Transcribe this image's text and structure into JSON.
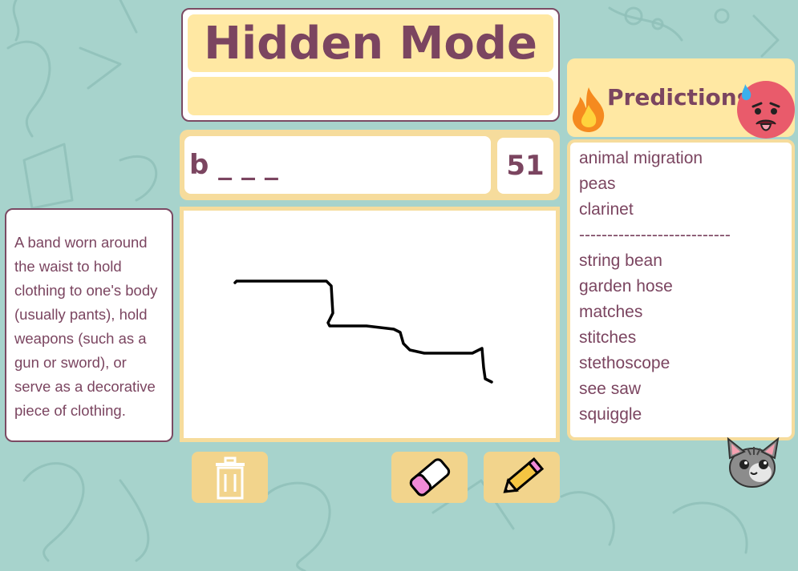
{
  "game": {
    "title": "Hidden Mode",
    "subtitle": "",
    "hint_word": "b _ _ _",
    "timer": "51"
  },
  "definition": {
    "text": "A band worn around the waist to hold clothing to one's body (usually pants), hold weapons (such as a gun or sword), or serve as a decorative piece of clothing."
  },
  "predictions": {
    "title": "Predictions",
    "items": [
      "animal migration",
      "peas",
      "clarinet",
      "---------------------------",
      "string bean",
      "garden hose",
      "matches",
      "stitches",
      "stethoscope",
      "see saw",
      "squiggle"
    ]
  },
  "tools": {
    "clear": "trash-icon",
    "eraser": "eraser-icon",
    "pencil": "pencil-icon"
  },
  "icons": {
    "hot": "fire-icon",
    "reaction": "hot-face-icon",
    "mascot": "cat-icon"
  },
  "colors": {
    "background": "#a7d3cc",
    "panel_yellow": "#ffe8a3",
    "button_yellow": "#f2d48c",
    "text_purple": "#7b4560",
    "border_purple": "#7b4a63"
  }
}
